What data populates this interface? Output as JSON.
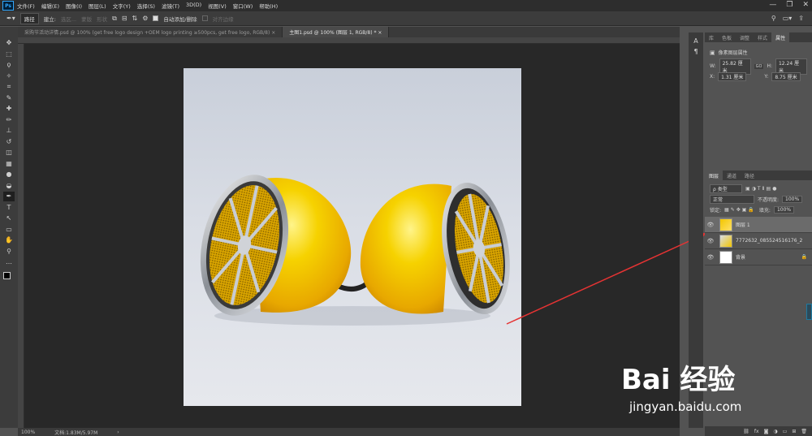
{
  "app": {
    "logo": "Ps"
  },
  "menubar": {
    "items": [
      "文件(F)",
      "编辑(E)",
      "图像(I)",
      "图层(L)",
      "文字(Y)",
      "选择(S)",
      "滤镜(T)",
      "3D(D)",
      "视图(V)",
      "窗口(W)",
      "帮助(H)"
    ]
  },
  "window_controls": {
    "minimize": "—",
    "restore": "❐",
    "close": "✕"
  },
  "options_bar": {
    "tool_icon": "pen-icon",
    "mode_value": "路径",
    "build_label": "建立:",
    "selection_label": "选区...",
    "mask_label": "蒙版",
    "shape_label": "形状",
    "auto_add_label": "自动添加/删除",
    "align_edges_label": "对齐边缘"
  },
  "tabs": [
    {
      "label": "采购节活动详情.psd @ 100% (get free logo design +OEM logo printing ≥500pcs,  get free logo, RGB/8) ×",
      "active": false
    },
    {
      "label": "主图1.psd @ 100% (图层 1, RGB/8) * ×",
      "active": true
    }
  ],
  "tools": [
    "move-icon",
    "marquee-icon",
    "lasso-icon",
    "magic-wand-icon",
    "crop-icon",
    "eyedropper-icon",
    "healing-icon",
    "brush-icon",
    "stamp-icon",
    "history-brush-icon",
    "eraser-icon",
    "gradient-icon",
    "blur-icon",
    "dodge-icon",
    "pen-icon",
    "type-icon",
    "path-select-icon",
    "rectangle-icon",
    "hand-icon",
    "zoom-icon",
    "more-icon"
  ],
  "tool_glyphs": [
    "✥",
    "⬚",
    "ϙ",
    "✧",
    "⌗",
    "✎",
    "✚",
    "✏",
    "⊥",
    "↺",
    "◫",
    "▦",
    "●",
    "◒",
    "✒",
    "T",
    "↖",
    "▭",
    "✋",
    "⚲",
    "…"
  ],
  "status_bar": {
    "zoom": "100%",
    "doc": "文档:1.83M/5.97M",
    "arrow": "›"
  },
  "properties_panel": {
    "tabs": [
      "库",
      "色板",
      "调整",
      "样式",
      "属性"
    ],
    "title": "像素图层属性",
    "w_label": "W:",
    "w_value": "25.82 厘米",
    "h_label": "H:",
    "h_value": "12.24 厘米",
    "x_label": "X:",
    "x_value": "1.31 厘米",
    "y_label": "Y:",
    "y_value": "8.75 厘米",
    "link_icon": "GO"
  },
  "layers_panel": {
    "tabs": [
      "图层",
      "通道",
      "路径"
    ],
    "filter_value": "ρ 类型",
    "blend_mode": "正常",
    "opacity_label": "不透明度:",
    "opacity_value": "100%",
    "lock_label": "锁定:",
    "fill_label": "填充:",
    "fill_value": "100%",
    "layers": [
      {
        "name": "图层 1",
        "selected": true
      },
      {
        "name": "7772632_085524516176_2",
        "selected": false
      },
      {
        "name": "背景",
        "selected": false,
        "locked": true
      }
    ]
  },
  "watermark": {
    "line1": "Bai 经验",
    "line2": "jingyan.baidu.com"
  },
  "colors": {
    "accent": "#31a8ff",
    "arrow": "#e53333",
    "product_yellow": "#f2c500"
  }
}
